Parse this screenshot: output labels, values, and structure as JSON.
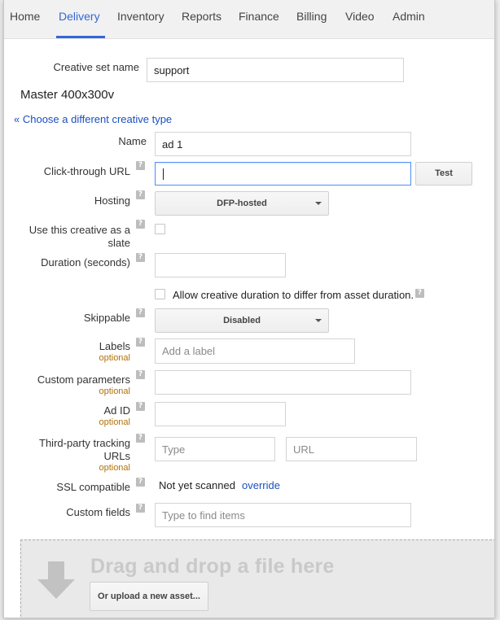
{
  "nav": {
    "tabs": [
      "Home",
      "Delivery",
      "Inventory",
      "Reports",
      "Finance",
      "Billing",
      "Video",
      "Admin"
    ],
    "active_tab": "Delivery"
  },
  "creative_set": {
    "label": "Creative set name",
    "value": "support"
  },
  "section_title": "Master 400x300v",
  "choose_link": "« Choose a different creative type",
  "fields": {
    "name": {
      "label": "Name",
      "value": "ad 1"
    },
    "click_through": {
      "label": "Click-through URL",
      "value": "",
      "test_button": "Test"
    },
    "hosting": {
      "label": "Hosting",
      "value": "DFP-hosted"
    },
    "slate": {
      "label_line1": "Use this creative as a",
      "label_line2": "slate"
    },
    "duration": {
      "label": "Duration (seconds)",
      "value": ""
    },
    "allow_duration": {
      "label": "Allow creative duration to differ from asset duration."
    },
    "skippable": {
      "label": "Skippable",
      "value": "Disabled"
    },
    "labels": {
      "label": "Labels",
      "optional": "optional",
      "placeholder": "Add a label"
    },
    "custom_params": {
      "label": "Custom parameters",
      "optional": "optional",
      "value": ""
    },
    "ad_id": {
      "label": "Ad ID",
      "optional": "optional",
      "value": ""
    },
    "tracking": {
      "label_line1": "Third-party tracking",
      "label_line2": "URLs",
      "optional": "optional",
      "type_placeholder": "Type",
      "url_placeholder": "URL"
    },
    "ssl": {
      "label": "SSL compatible",
      "value": "Not yet scanned",
      "override": "override"
    },
    "custom_fields": {
      "label": "Custom fields",
      "placeholder": "Type to find items"
    }
  },
  "dropzone": {
    "title": "Drag and drop a file here",
    "upload_button": "Or upload a new asset..."
  },
  "help_glyph": "?",
  "colors": {
    "accent": "#3367d6",
    "link": "#1a4fc1",
    "optional": "#b2710a",
    "focus_border": "#4d90fe"
  }
}
